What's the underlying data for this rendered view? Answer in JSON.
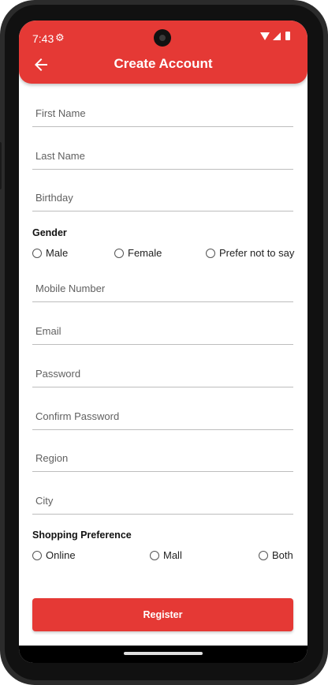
{
  "status_bar": {
    "time": "7:43",
    "gear_icon": "gear-icon",
    "icons": [
      "wifi-icon",
      "signal-icon",
      "battery-icon"
    ]
  },
  "app_bar": {
    "title": "Create Account",
    "back_icon": "arrow-left-icon",
    "color": "#e53935"
  },
  "form": {
    "first_name": {
      "placeholder": "First Name",
      "value": ""
    },
    "last_name": {
      "placeholder": "Last Name",
      "value": ""
    },
    "birthday": {
      "placeholder": "Birthday",
      "value": ""
    },
    "gender": {
      "label": "Gender",
      "options": [
        "Male",
        "Female",
        "Prefer not to say"
      ]
    },
    "mobile": {
      "placeholder": "Mobile Number",
      "value": ""
    },
    "email": {
      "placeholder": "Email",
      "value": ""
    },
    "password": {
      "placeholder": "Password",
      "value": ""
    },
    "confirm_password": {
      "placeholder": "Confirm Password",
      "value": ""
    },
    "region": {
      "placeholder": "Region",
      "value": ""
    },
    "city": {
      "placeholder": "City",
      "value": ""
    },
    "shopping": {
      "label": "Shopping Preference",
      "options": [
        "Online",
        "Mall",
        "Both"
      ]
    },
    "register_label": "Register"
  }
}
